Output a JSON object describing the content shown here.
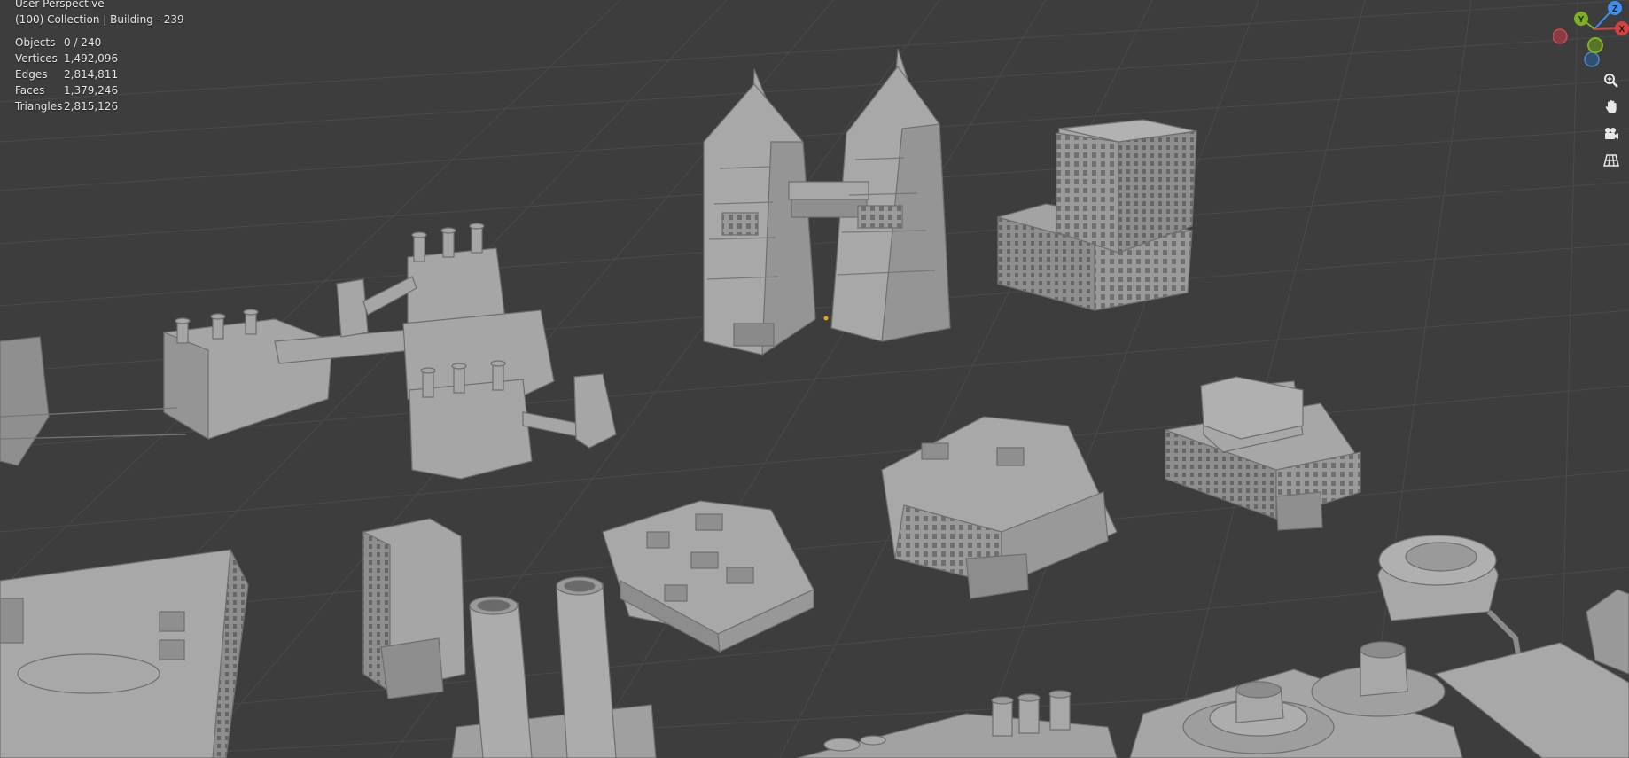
{
  "viewport": {
    "perspective_label": "User Perspective",
    "collection_label": "(100) Collection | Building - 239",
    "stats": [
      {
        "label": "Objects",
        "value": "0 / 240"
      },
      {
        "label": "Vertices",
        "value": "1,492,096"
      },
      {
        "label": "Edges",
        "value": "2,814,811"
      },
      {
        "label": "Faces",
        "value": "1,379,246"
      },
      {
        "label": "Triangles",
        "value": "2,815,126"
      }
    ]
  },
  "gizmo": {
    "x_label": "X",
    "y_label": "Y",
    "z_label": "Z"
  },
  "navigation_tools": [
    {
      "name": "zoom",
      "icon": "zoom-icon"
    },
    {
      "name": "pan",
      "icon": "hand-icon"
    },
    {
      "name": "camera",
      "icon": "camera-icon"
    },
    {
      "name": "toggle-perspective",
      "icon": "grid-icon"
    }
  ],
  "colors": {
    "background": "#3d3d3d",
    "grid": "#4a4a4a",
    "model": "#a8a8a8",
    "axis_x": "#d5413f",
    "axis_y": "#7fb021",
    "axis_z": "#3d8ff0",
    "origin": "#f0a020"
  }
}
